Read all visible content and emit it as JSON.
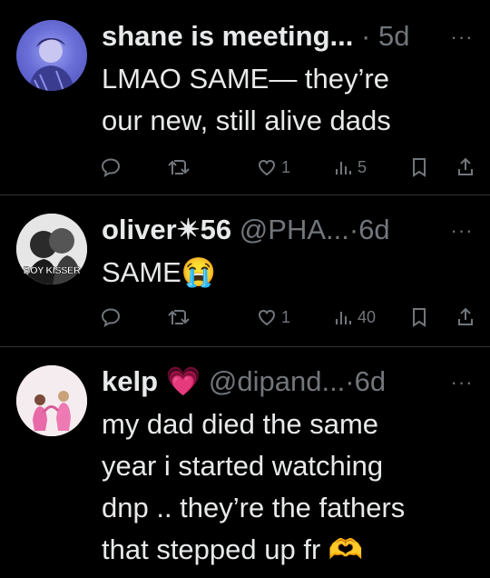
{
  "tweets": [
    {
      "name": "shane is meeting...",
      "handle": "",
      "dot": "·",
      "time": "5d",
      "body": [
        "LMAO SAME— they’re",
        "our new, still alive dads"
      ],
      "reply_count": "",
      "retweet_count": "",
      "like_count": "1",
      "view_count": "5",
      "avatar_label": ""
    },
    {
      "name": "oliver✴︎56",
      "handle": "@PHA...",
      "dot": "·",
      "time": "6d",
      "body": [
        "SAME"
      ],
      "emoji": "😭",
      "reply_count": "",
      "retweet_count": "",
      "like_count": "1",
      "view_count": "40",
      "avatar_label": "BOY KISSER"
    },
    {
      "name": "kelp",
      "name_emoji": "💗",
      "handle": "@dipand...",
      "dot": "·",
      "time": "6d",
      "body": [
        "my dad died the same",
        "year i started watching",
        "dnp .. they’re the fathers",
        "that stepped up fr"
      ],
      "end_emoji": "🫶",
      "avatar_label": ""
    }
  ],
  "more_glyph": "···",
  "icons": [
    "reply-icon",
    "retweet-icon",
    "like-icon",
    "views-icon",
    "bookmark-icon",
    "share-icon"
  ],
  "colors": {
    "background": "#000000",
    "text": "#e7e9ea",
    "muted": "#71767b",
    "divider": "#2f3336"
  }
}
